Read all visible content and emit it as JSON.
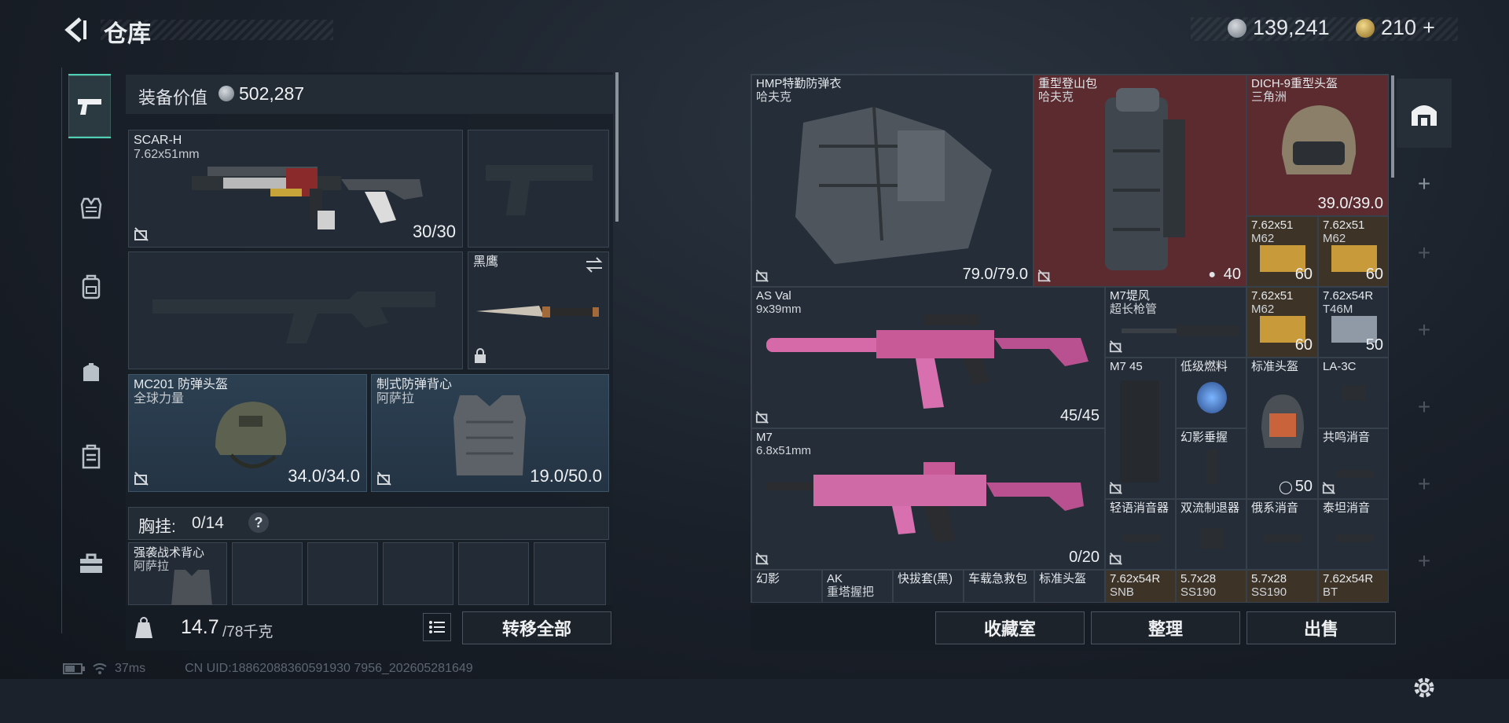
{
  "header": {
    "title": "仓库",
    "currency1": "139,241",
    "currency2": "210",
    "currency2_plus": "+"
  },
  "left": {
    "equip_value_label": "装备价值",
    "equip_value": "502,287",
    "primary": {
      "name": "SCAR-H",
      "caliber": "7.62x51mm",
      "ammo": "30/30"
    },
    "melee": {
      "name": "黑鹰"
    },
    "helmet": {
      "name": "MC201 防弹头盔",
      "maker": "全球力量",
      "durability": "34.0/34.0"
    },
    "armor": {
      "name": "制式防弹背心",
      "maker": "阿萨拉",
      "durability": "19.0/50.0"
    },
    "chest_rig_label": "胸挂:",
    "chest_rig_count": "0/14",
    "chest_help": "?",
    "rig_item": {
      "name": "强袭战术背心",
      "maker": "阿萨拉"
    },
    "weight_value": "14.7",
    "weight_max": "/78千克",
    "transfer_all": "转移全部"
  },
  "stash": {
    "items": [
      {
        "name": "HMP特勤防弹衣",
        "sub": "哈夫克",
        "value": "79.0/79.0"
      },
      {
        "name": "重型登山包",
        "sub": "哈夫克",
        "value": "40"
      },
      {
        "name": "DICH-9重型头盔",
        "sub": "三角洲",
        "value": "39.0/39.0"
      },
      {
        "name": "7.62x51",
        "sub": "M62",
        "value": "60"
      },
      {
        "name": "7.62x51",
        "sub": "M62",
        "value": "60"
      },
      {
        "name": "AS Val",
        "sub": "9x39mm",
        "value": "45/45"
      },
      {
        "name": "M7堤风",
        "sub": "超长枪管",
        "value": ""
      },
      {
        "name": "7.62x51",
        "sub": "M62",
        "value": "60"
      },
      {
        "name": "7.62x54R",
        "sub": "T46M",
        "value": "50"
      },
      {
        "name": "M7 45",
        "sub": "",
        "value": ""
      },
      {
        "name": "低级燃料",
        "sub": "",
        "value": ""
      },
      {
        "name": "标准头盔",
        "sub": "",
        "value": "50"
      },
      {
        "name": "LA-3C",
        "sub": "",
        "value": ""
      },
      {
        "name": "幻影垂握",
        "sub": "",
        "value": ""
      },
      {
        "name": "共鸣消音",
        "sub": "",
        "value": ""
      },
      {
        "name": "M7",
        "sub": "6.8x51mm",
        "value": "0/20"
      },
      {
        "name": "轻语消音器",
        "sub": "",
        "value": ""
      },
      {
        "name": "双流制退器",
        "sub": "",
        "value": ""
      },
      {
        "name": "俄系消音",
        "sub": "",
        "value": ""
      },
      {
        "name": "泰坦消音",
        "sub": "",
        "value": ""
      },
      {
        "name": "幻影",
        "sub": "",
        "value": ""
      },
      {
        "name": "AK",
        "sub": "重塔握把",
        "value": ""
      },
      {
        "name": "快拔套(黑)",
        "sub": "",
        "value": ""
      },
      {
        "name": "车载急救包",
        "sub": "",
        "value": ""
      },
      {
        "name": "标准头盔",
        "sub": "",
        "value": ""
      },
      {
        "name": "7.62x54R",
        "sub": "SNB",
        "value": ""
      },
      {
        "name": "5.7x28",
        "sub": "SS190",
        "value": ""
      },
      {
        "name": "5.7x28",
        "sub": "SS190",
        "value": ""
      },
      {
        "name": "7.62x54R",
        "sub": "BT",
        "value": ""
      }
    ]
  },
  "bottom": {
    "collection_room": "收藏室",
    "sort": "整理",
    "sell": "出售"
  },
  "status": {
    "ping": "37ms",
    "uid": "CN UID:18862088360591930 7956_202605281649"
  },
  "colors": {
    "accent": "#4fd0b5",
    "backpack_bg": "#5b2b2f"
  }
}
